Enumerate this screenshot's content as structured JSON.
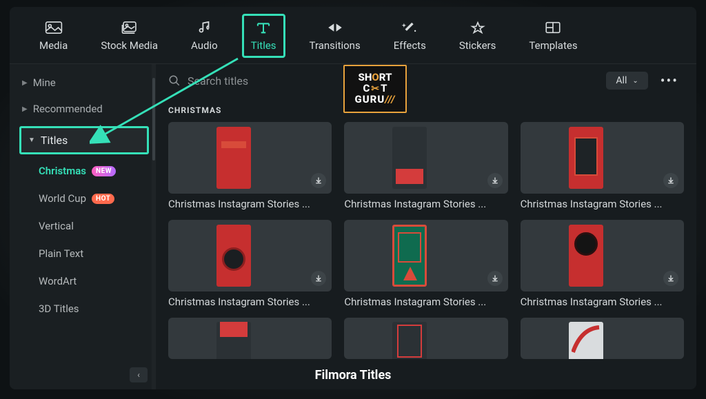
{
  "topTabs": [
    {
      "id": "media",
      "label": "Media"
    },
    {
      "id": "stock",
      "label": "Stock Media"
    },
    {
      "id": "audio",
      "label": "Audio"
    },
    {
      "id": "titles",
      "label": "Titles",
      "selected": true
    },
    {
      "id": "transitions",
      "label": "Transitions"
    },
    {
      "id": "effects",
      "label": "Effects"
    },
    {
      "id": "stickers",
      "label": "Stickers"
    },
    {
      "id": "templates",
      "label": "Templates"
    }
  ],
  "sidebar": {
    "mine": "Mine",
    "recommended": "Recommended",
    "titles": "Titles",
    "items": [
      {
        "label": "Christmas",
        "badge": "NEW",
        "badgeClass": "new",
        "active": true
      },
      {
        "label": "World Cup",
        "badge": "HOT",
        "badgeClass": "hot"
      },
      {
        "label": "Vertical"
      },
      {
        "label": "Plain Text"
      },
      {
        "label": "WordArt"
      },
      {
        "label": "3D Titles"
      }
    ]
  },
  "search": {
    "placeholder": "Search titles"
  },
  "filter": {
    "label": "All"
  },
  "section": {
    "label": "CHRISTMAS"
  },
  "cards": [
    {
      "title": "Christmas Instagram Stories ..."
    },
    {
      "title": "Christmas Instagram Stories ..."
    },
    {
      "title": "Christmas Instagram Stories ..."
    },
    {
      "title": "Christmas Instagram Stories ..."
    },
    {
      "title": "Christmas Instagram Stories ..."
    },
    {
      "title": "Christmas Instagram Stories ..."
    }
  ],
  "caption": "Filmora Titles",
  "logo": {
    "l1a": "SH",
    "l1b": "O",
    "l1c": "RT",
    "l2a": "C",
    "l2b": "T",
    "l3a": "GURU",
    "l3b": "///"
  },
  "colors": {
    "accent": "#35e0b8",
    "red": "#c62f2f",
    "orange": "#e8a23c"
  }
}
